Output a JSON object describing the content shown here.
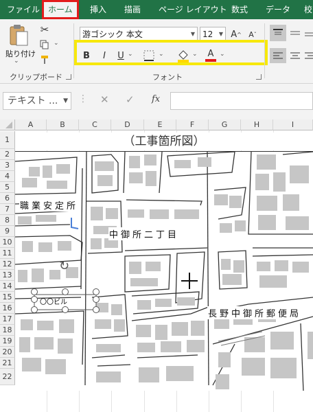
{
  "tabs": [
    "ファイル",
    "ホーム",
    "挿入",
    "描画",
    "ページ レイアウト",
    "数式",
    "データ",
    "校"
  ],
  "active_tab": "ホーム",
  "clipboard": {
    "paste_label": "貼り付け",
    "group_label": "クリップボード"
  },
  "font": {
    "name": "游ゴシック 本文",
    "size": "12",
    "group_label": "フォント",
    "grow_label": "A",
    "shrink_label": "A",
    "bold": "B",
    "italic": "I",
    "underline": "U",
    "font_color_label": "A"
  },
  "formula": {
    "namebox": "テキスト ...",
    "fx": "fx",
    "cancel": "✕",
    "enter": "✓"
  },
  "columns": [
    "A",
    "B",
    "C",
    "D",
    "E",
    "F",
    "G",
    "H",
    "I"
  ],
  "rows": [
    "1",
    "2",
    "3",
    "4",
    "5",
    "6",
    "7",
    "8",
    "9",
    "10",
    "11",
    "12",
    "13",
    "14",
    "15",
    "16",
    "17",
    "18",
    "19",
    "20",
    "21",
    "22"
  ],
  "sheet": {
    "title": "（工事箇所図）"
  },
  "map_labels": {
    "employment_office": "職業安定所",
    "district": "中御所二丁目",
    "post_office": "長野中御所郵便局",
    "building": "〇〇ビル"
  },
  "colors": {
    "accent": "#217346",
    "highlight_tab_border": "#e31c1c",
    "font_box_border": "#f7e80c",
    "font_color_bar": "#e31c1c",
    "fill_color_bar": "#ffd800"
  }
}
